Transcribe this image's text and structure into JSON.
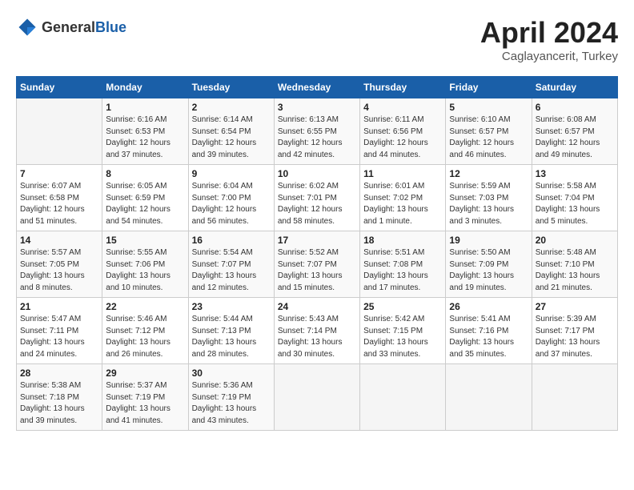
{
  "header": {
    "logo_general": "General",
    "logo_blue": "Blue",
    "title": "April 2024",
    "subtitle": "Caglayancerit, Turkey"
  },
  "weekdays": [
    "Sunday",
    "Monday",
    "Tuesday",
    "Wednesday",
    "Thursday",
    "Friday",
    "Saturday"
  ],
  "weeks": [
    [
      {
        "day": "",
        "info": ""
      },
      {
        "day": "1",
        "info": "Sunrise: 6:16 AM\nSunset: 6:53 PM\nDaylight: 12 hours\nand 37 minutes."
      },
      {
        "day": "2",
        "info": "Sunrise: 6:14 AM\nSunset: 6:54 PM\nDaylight: 12 hours\nand 39 minutes."
      },
      {
        "day": "3",
        "info": "Sunrise: 6:13 AM\nSunset: 6:55 PM\nDaylight: 12 hours\nand 42 minutes."
      },
      {
        "day": "4",
        "info": "Sunrise: 6:11 AM\nSunset: 6:56 PM\nDaylight: 12 hours\nand 44 minutes."
      },
      {
        "day": "5",
        "info": "Sunrise: 6:10 AM\nSunset: 6:57 PM\nDaylight: 12 hours\nand 46 minutes."
      },
      {
        "day": "6",
        "info": "Sunrise: 6:08 AM\nSunset: 6:57 PM\nDaylight: 12 hours\nand 49 minutes."
      }
    ],
    [
      {
        "day": "7",
        "info": "Sunrise: 6:07 AM\nSunset: 6:58 PM\nDaylight: 12 hours\nand 51 minutes."
      },
      {
        "day": "8",
        "info": "Sunrise: 6:05 AM\nSunset: 6:59 PM\nDaylight: 12 hours\nand 54 minutes."
      },
      {
        "day": "9",
        "info": "Sunrise: 6:04 AM\nSunset: 7:00 PM\nDaylight: 12 hours\nand 56 minutes."
      },
      {
        "day": "10",
        "info": "Sunrise: 6:02 AM\nSunset: 7:01 PM\nDaylight: 12 hours\nand 58 minutes."
      },
      {
        "day": "11",
        "info": "Sunrise: 6:01 AM\nSunset: 7:02 PM\nDaylight: 13 hours\nand 1 minute."
      },
      {
        "day": "12",
        "info": "Sunrise: 5:59 AM\nSunset: 7:03 PM\nDaylight: 13 hours\nand 3 minutes."
      },
      {
        "day": "13",
        "info": "Sunrise: 5:58 AM\nSunset: 7:04 PM\nDaylight: 13 hours\nand 5 minutes."
      }
    ],
    [
      {
        "day": "14",
        "info": "Sunrise: 5:57 AM\nSunset: 7:05 PM\nDaylight: 13 hours\nand 8 minutes."
      },
      {
        "day": "15",
        "info": "Sunrise: 5:55 AM\nSunset: 7:06 PM\nDaylight: 13 hours\nand 10 minutes."
      },
      {
        "day": "16",
        "info": "Sunrise: 5:54 AM\nSunset: 7:07 PM\nDaylight: 13 hours\nand 12 minutes."
      },
      {
        "day": "17",
        "info": "Sunrise: 5:52 AM\nSunset: 7:07 PM\nDaylight: 13 hours\nand 15 minutes."
      },
      {
        "day": "18",
        "info": "Sunrise: 5:51 AM\nSunset: 7:08 PM\nDaylight: 13 hours\nand 17 minutes."
      },
      {
        "day": "19",
        "info": "Sunrise: 5:50 AM\nSunset: 7:09 PM\nDaylight: 13 hours\nand 19 minutes."
      },
      {
        "day": "20",
        "info": "Sunrise: 5:48 AM\nSunset: 7:10 PM\nDaylight: 13 hours\nand 21 minutes."
      }
    ],
    [
      {
        "day": "21",
        "info": "Sunrise: 5:47 AM\nSunset: 7:11 PM\nDaylight: 13 hours\nand 24 minutes."
      },
      {
        "day": "22",
        "info": "Sunrise: 5:46 AM\nSunset: 7:12 PM\nDaylight: 13 hours\nand 26 minutes."
      },
      {
        "day": "23",
        "info": "Sunrise: 5:44 AM\nSunset: 7:13 PM\nDaylight: 13 hours\nand 28 minutes."
      },
      {
        "day": "24",
        "info": "Sunrise: 5:43 AM\nSunset: 7:14 PM\nDaylight: 13 hours\nand 30 minutes."
      },
      {
        "day": "25",
        "info": "Sunrise: 5:42 AM\nSunset: 7:15 PM\nDaylight: 13 hours\nand 33 minutes."
      },
      {
        "day": "26",
        "info": "Sunrise: 5:41 AM\nSunset: 7:16 PM\nDaylight: 13 hours\nand 35 minutes."
      },
      {
        "day": "27",
        "info": "Sunrise: 5:39 AM\nSunset: 7:17 PM\nDaylight: 13 hours\nand 37 minutes."
      }
    ],
    [
      {
        "day": "28",
        "info": "Sunrise: 5:38 AM\nSunset: 7:18 PM\nDaylight: 13 hours\nand 39 minutes."
      },
      {
        "day": "29",
        "info": "Sunrise: 5:37 AM\nSunset: 7:19 PM\nDaylight: 13 hours\nand 41 minutes."
      },
      {
        "day": "30",
        "info": "Sunrise: 5:36 AM\nSunset: 7:19 PM\nDaylight: 13 hours\nand 43 minutes."
      },
      {
        "day": "",
        "info": ""
      },
      {
        "day": "",
        "info": ""
      },
      {
        "day": "",
        "info": ""
      },
      {
        "day": "",
        "info": ""
      }
    ]
  ]
}
